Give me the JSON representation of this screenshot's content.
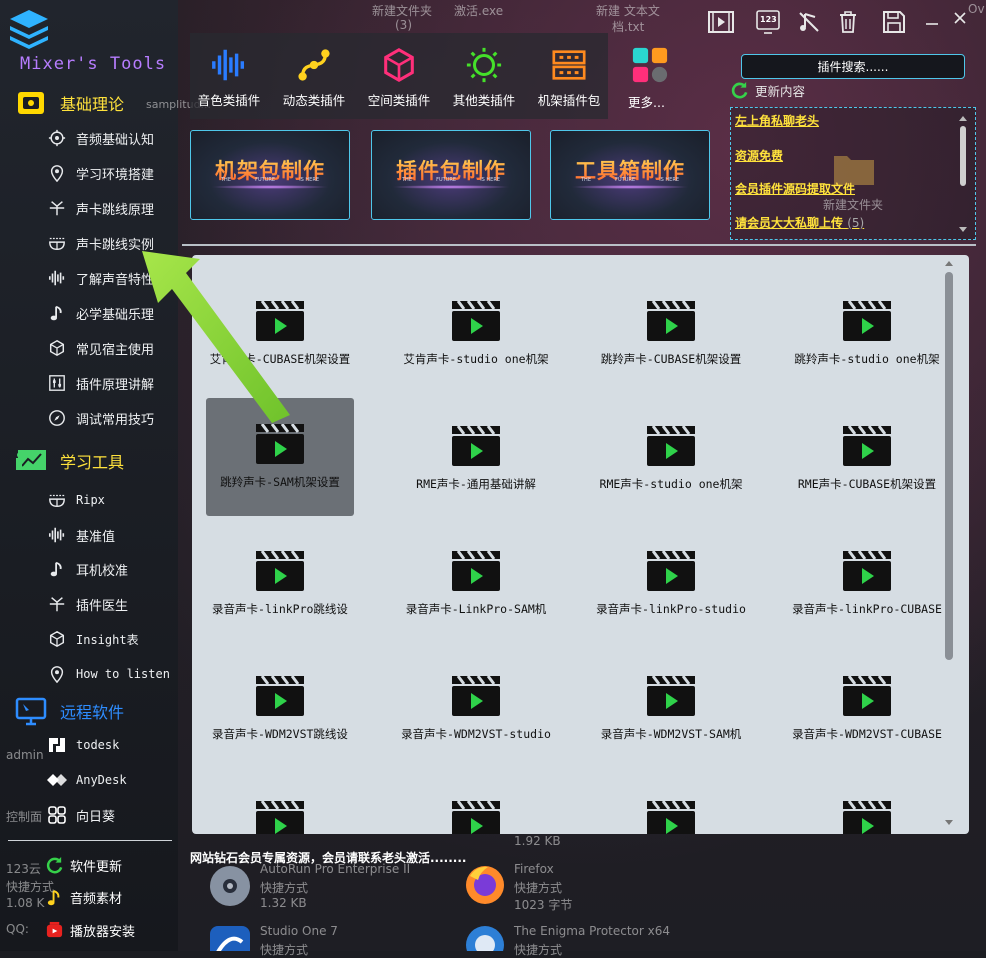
{
  "app": {
    "title": "Mixer's Tools"
  },
  "desktop": {
    "top_files": [
      "新建文件夹",
      "(3)",
      "激活.exe",
      "新建 文本文",
      "档.txt",
      "Ov"
    ],
    "ghost_left": [
      "samplitud...",
      "admin",
      "控制面",
      "123云",
      "快捷方式",
      "1.08 K",
      "QQ:"
    ],
    "folder_label": "新建文件夹",
    "bottom_items": [
      {
        "name": "AutoRun Pro Enterprise II",
        "type": "快捷方式",
        "size": "1.32 KB"
      },
      {
        "name": "Firefox",
        "type": "快捷方式",
        "size": "1023 字节"
      },
      {
        "name": "Studio One 7",
        "type": "快捷方式"
      },
      {
        "name": "The Enigma Protector x64",
        "type": "快捷方式"
      }
    ],
    "file_size_top": "1.92 KB"
  },
  "sidebar": {
    "sections": [
      {
        "title": "基础理论",
        "items": [
          {
            "label": "音频基础认知",
            "icon": "brain-gear-icon"
          },
          {
            "label": "学习环境搭建",
            "icon": "location-pin-icon"
          },
          {
            "label": "声卡跳线原理",
            "icon": "split-arrow-icon"
          },
          {
            "label": "声卡跳线实例",
            "icon": "bowl-icon"
          },
          {
            "label": "了解声音特性",
            "icon": "waveform-icon"
          },
          {
            "label": "必学基础乐理",
            "icon": "music-note-icon"
          },
          {
            "label": "常见宿主使用",
            "icon": "cube-icon"
          },
          {
            "label": "插件原理讲解",
            "icon": "sliders-icon"
          },
          {
            "label": "调试常用技巧",
            "icon": "compass-icon"
          }
        ]
      },
      {
        "title": "学习工具",
        "items": [
          {
            "label": "Ripx",
            "icon": "bowl-icon"
          },
          {
            "label": "基准值",
            "icon": "waveform-icon"
          },
          {
            "label": "耳机校准",
            "icon": "music-note-icon"
          },
          {
            "label": "插件医生",
            "icon": "split-arrow-icon"
          },
          {
            "label": "Insight表",
            "icon": "cube-icon"
          },
          {
            "label": "How to listen",
            "icon": "location-pin-icon"
          }
        ]
      },
      {
        "title": "远程软件",
        "items": [
          {
            "label": "todesk",
            "icon": "todesk-icon"
          },
          {
            "label": "AnyDesk",
            "icon": "anydesk-icon"
          },
          {
            "label": "向日葵",
            "icon": "sunflower-icon"
          }
        ]
      }
    ],
    "bottom": [
      {
        "label": "软件更新",
        "icon": "refresh-icon"
      },
      {
        "label": "音频素材",
        "icon": "music-note-icon"
      },
      {
        "label": "播放器安装",
        "icon": "player-icon"
      }
    ]
  },
  "categories": [
    {
      "label": "音色类插件",
      "icon": "waveform-icon",
      "color": "#2a7cff"
    },
    {
      "label": "动态类插件",
      "icon": "bezier-icon",
      "color": "#ffd21e"
    },
    {
      "label": "空间类插件",
      "icon": "cube-icon",
      "color": "#ff2f7a"
    },
    {
      "label": "其他类插件",
      "icon": "sun-icon",
      "color": "#45e02a"
    },
    {
      "label": "机架插件包",
      "icon": "rack-icon",
      "color": "#ff8a1f"
    },
    {
      "label": "更多...",
      "icon": "apps-grid-icon",
      "color": "#2ad6d0"
    }
  ],
  "banners": [
    {
      "label": "机架包制作"
    },
    {
      "label": "插件包制作"
    },
    {
      "label": "工具箱制作"
    }
  ],
  "banner_small": [
    "THE",
    "FUTURE",
    "IS HERE"
  ],
  "search": {
    "placeholder": "插件搜索......"
  },
  "updates": {
    "title": "更新内容",
    "links": [
      {
        "text": "左上角私聊老头",
        "count": ""
      },
      {
        "text": "资源免费",
        "count": ""
      },
      {
        "text": "会员插件源码提取文件",
        "count": ""
      },
      {
        "text": "请会员大大私聊上传",
        "count": "(5)"
      }
    ]
  },
  "videos": [
    {
      "label": "艾肯声卡-CUBASE机架设置"
    },
    {
      "label": "艾肯声卡-studio one机架"
    },
    {
      "label": "跳羚声卡-CUBASE机架设置"
    },
    {
      "label": "跳羚声卡-studio one机架"
    },
    {
      "label": "跳羚声卡-SAM机架设置",
      "selected": true
    },
    {
      "label": "RME声卡-通用基础讲解"
    },
    {
      "label": "RME声卡-studio one机架"
    },
    {
      "label": "RME声卡-CUBASE机架设置"
    },
    {
      "label": "录音声卡-linkPro跳线设"
    },
    {
      "label": "录音声卡-LinkPro-SAM机"
    },
    {
      "label": "录音声卡-linkPro-studio"
    },
    {
      "label": "录音声卡-linkPro-CUBASE"
    },
    {
      "label": "录音声卡-WDM2VST跳线设"
    },
    {
      "label": "录音声卡-WDM2VST-studio"
    },
    {
      "label": "录音声卡-WDM2VST-SAM机"
    },
    {
      "label": "录音声卡-WDM2VST-CUBASE"
    },
    {
      "label": ""
    },
    {
      "label": ""
    },
    {
      "label": ""
    },
    {
      "label": ""
    }
  ],
  "notice": "网站钻石会员专属资源，会员请联系老头激活........",
  "toolbar": {
    "icons": [
      "video-icon",
      "keypad-123-icon",
      "music-off-icon",
      "trash-icon",
      "save-icon",
      "minimize-icon",
      "close-icon"
    ],
    "keypad_label": "123"
  },
  "colors": {
    "accent_yellow": "#ffe23c",
    "accent_blue": "#2e8dff",
    "accent_cyan": "#4fc7ea",
    "arrow_green": "#8fd63a"
  }
}
